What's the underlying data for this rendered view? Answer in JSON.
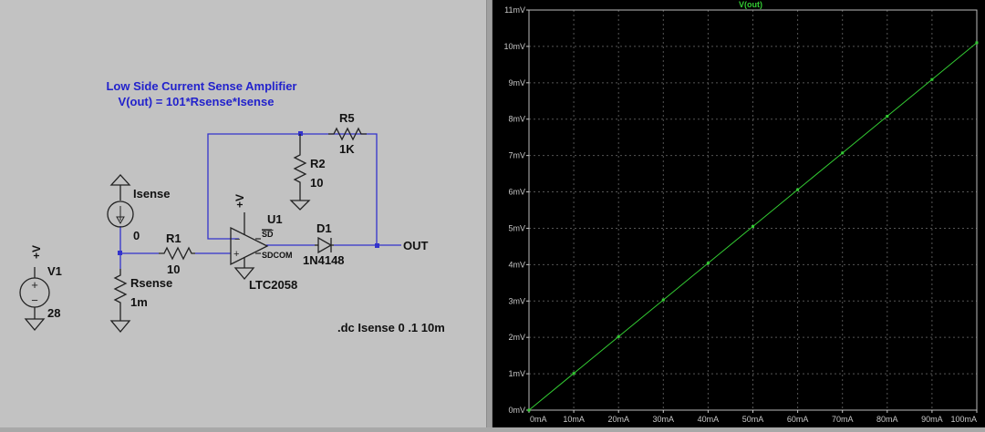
{
  "schematic": {
    "title_line1": "Low Side Current Sense Amplifier",
    "title_line2": "V(out) = 101*Rsense*Isense",
    "directive": ".dc Isense 0 .1 10m",
    "components": {
      "v1": {
        "name": "V1",
        "value": "28",
        "pin_label": "+V"
      },
      "isense": {
        "name": "Isense",
        "value": "0"
      },
      "r1": {
        "name": "R1",
        "value": "10"
      },
      "rsense": {
        "name": "Rsense",
        "value": "1m"
      },
      "r2": {
        "name": "R2",
        "value": "10"
      },
      "r5": {
        "name": "R5",
        "value": "1K"
      },
      "u1": {
        "name": "U1",
        "part": "LTC2058",
        "supply_label": "+V",
        "pin_sd": "SD",
        "pin_sdcom": "SDCOM"
      },
      "d1": {
        "name": "D1",
        "part": "1N4148"
      },
      "out": {
        "label": "OUT"
      }
    }
  },
  "chart_data": {
    "type": "line",
    "title": "V(out)",
    "x_ticks": [
      "0mA",
      "10mA",
      "20mA",
      "30mA",
      "40mA",
      "50mA",
      "60mA",
      "70mA",
      "80mA",
      "90mA",
      "100mA"
    ],
    "y_ticks": [
      "0mV",
      "1mV",
      "2mV",
      "3mV",
      "4mV",
      "5mV",
      "6mV",
      "7mV",
      "8mV",
      "9mV",
      "10mV",
      "11mV"
    ],
    "xlim": [
      0,
      100
    ],
    "ylim": [
      0,
      11
    ],
    "x_unit": "mA",
    "y_unit": "mV",
    "grid": true,
    "series": [
      {
        "name": "V(out)",
        "color": "#33cc33",
        "x": [
          0,
          10,
          20,
          30,
          40,
          50,
          60,
          70,
          80,
          90,
          100
        ],
        "y": [
          0,
          1.01,
          2.02,
          3.03,
          4.04,
          5.05,
          6.06,
          7.07,
          8.08,
          9.09,
          10.1
        ]
      }
    ]
  },
  "colors": {
    "schematic_bg": "#c2c2c2",
    "wire": "#3333cc",
    "component": "#222222",
    "label": "#111111",
    "title_text": "#2222cc",
    "plot_bg": "#000000",
    "plot_axis_text": "#c8c8c8",
    "plot_grid": "#555555",
    "trace": "#33cc33"
  }
}
